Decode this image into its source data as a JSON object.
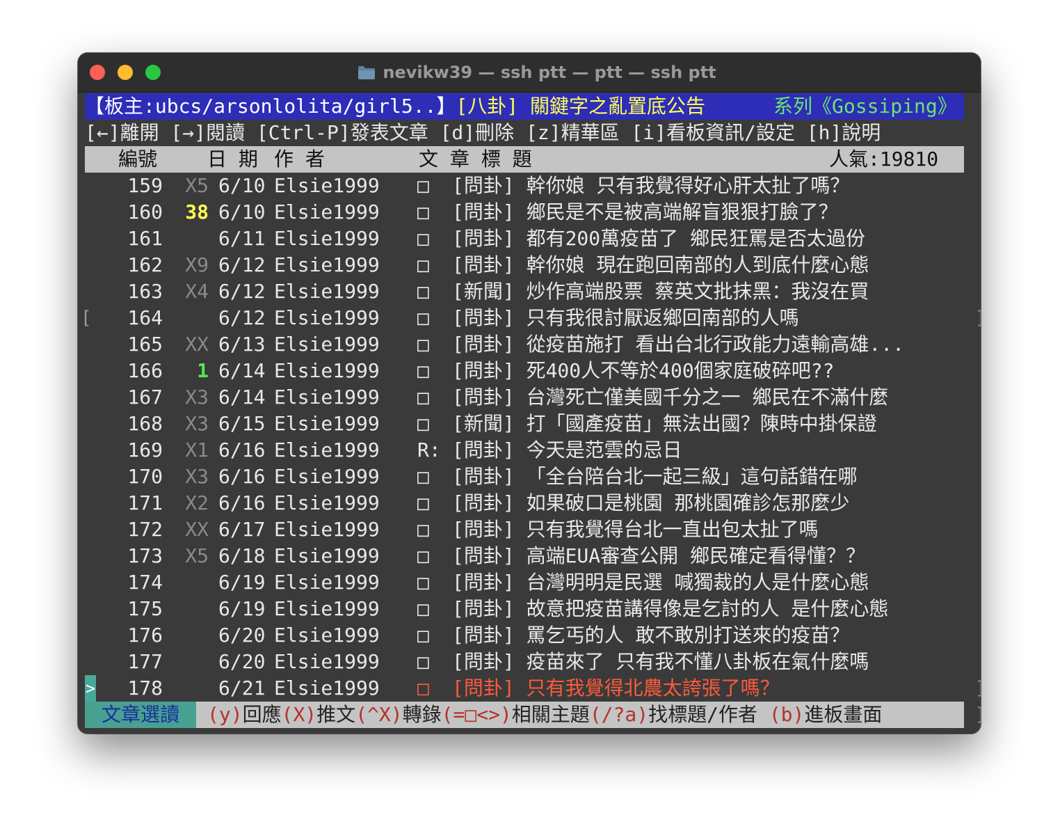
{
  "window": {
    "title": "nevikw39 — ssh ptt — ptt — ssh ptt",
    "buttons": [
      "close",
      "minimize",
      "zoom"
    ]
  },
  "header": {
    "moderators": "【板主:ubcs/arsonlolita/girl5..】",
    "title": "[八卦] 關鍵字之亂置底公告",
    "series": "系列《Gossiping》"
  },
  "menu": "[←]離開 [→]閱讀 [Ctrl-P]發表文章 [d]刪除 [z]精華區 [i]看板資訊/設定 [h]說明",
  "columns": {
    "number": "編號",
    "date": "日 期",
    "author": "作  者",
    "title": "文  章  標  題",
    "popularity": "人氣:19810"
  },
  "posts": [
    {
      "num": "159",
      "rec": "X5",
      "date": "6/10",
      "author": "Elsie1999",
      "mark": "□",
      "title": "[問卦] 幹你娘 只有我覺得好心肝太扯了嗎？"
    },
    {
      "num": "160",
      "rec": "38",
      "date": "6/10",
      "author": "Elsie1999",
      "mark": "□",
      "title": "[問卦] 鄉民是不是被高端解盲狠狠打臉了？"
    },
    {
      "num": "161",
      "rec": "",
      "date": "6/11",
      "author": "Elsie1999",
      "mark": "□",
      "title": "[問卦] 都有200萬疫苗了 鄉民狂罵是否太過份"
    },
    {
      "num": "162",
      "rec": "X9",
      "date": "6/12",
      "author": "Elsie1999",
      "mark": "□",
      "title": "[問卦] 幹你娘 現在跑回南部的人到底什麼心態"
    },
    {
      "num": "163",
      "rec": "X4",
      "date": "6/12",
      "author": "Elsie1999",
      "mark": "□",
      "title": "[新聞] 炒作高端股票 蔡英文批抹黑：我沒在買"
    },
    {
      "num": "164",
      "rec": "",
      "date": "6/12",
      "author": "Elsie1999",
      "mark": "□",
      "title": "[問卦] 只有我很討厭返鄉回南部的人嗎"
    },
    {
      "num": "165",
      "rec": "XX",
      "date": "6/13",
      "author": "Elsie1999",
      "mark": "□",
      "title": "[問卦] 從疫苗施打 看出台北行政能力遠輸高雄..."
    },
    {
      "num": "166",
      "rec": "1",
      "date": "6/14",
      "author": "Elsie1999",
      "mark": "□",
      "title": "[問卦] 死400人不等於400個家庭破碎吧??"
    },
    {
      "num": "167",
      "rec": "X3",
      "date": "6/14",
      "author": "Elsie1999",
      "mark": "□",
      "title": "[問卦] 台灣死亡僅美國千分之一 鄉民在不滿什麼"
    },
    {
      "num": "168",
      "rec": "X3",
      "date": "6/15",
      "author": "Elsie1999",
      "mark": "□",
      "title": "[新聞] 打「國產疫苗」無法出國？陳時中掛保證"
    },
    {
      "num": "169",
      "rec": "X1",
      "date": "6/16",
      "author": "Elsie1999",
      "mark": "R:",
      "title": "[問卦] 今天是范雲的忌日"
    },
    {
      "num": "170",
      "rec": "X3",
      "date": "6/16",
      "author": "Elsie1999",
      "mark": "□",
      "title": "[問卦] 「全台陪台北一起三級」這句話錯在哪"
    },
    {
      "num": "171",
      "rec": "X2",
      "date": "6/16",
      "author": "Elsie1999",
      "mark": "□",
      "title": "[問卦] 如果破口是桃園 那桃園確診怎那麼少"
    },
    {
      "num": "172",
      "rec": "XX",
      "date": "6/17",
      "author": "Elsie1999",
      "mark": "□",
      "title": "[問卦] 只有我覺得台北一直出包太扯了嗎"
    },
    {
      "num": "173",
      "rec": "X5",
      "date": "6/18",
      "author": "Elsie1999",
      "mark": "□",
      "title": "[問卦] 高端EUA審查公開 鄉民確定看得懂？？"
    },
    {
      "num": "174",
      "rec": "",
      "date": "6/19",
      "author": "Elsie1999",
      "mark": "□",
      "title": "[問卦] 台灣明明是民選 喊獨裁的人是什麼心態"
    },
    {
      "num": "175",
      "rec": "",
      "date": "6/19",
      "author": "Elsie1999",
      "mark": "□",
      "title": "[問卦] 故意把疫苗講得像是乞討的人 是什麼心態"
    },
    {
      "num": "176",
      "rec": "",
      "date": "6/20",
      "author": "Elsie1999",
      "mark": "□",
      "title": "[問卦] 罵乞丐的人 敢不敢別打送來的疫苗？"
    },
    {
      "num": "177",
      "rec": "",
      "date": "6/20",
      "author": "Elsie1999",
      "mark": "□",
      "title": "[問卦] 疫苗來了 只有我不懂八卦板在氣什麼嗎"
    },
    {
      "num": "178",
      "rec": "",
      "date": "6/21",
      "author": "Elsie1999",
      "mark": "□",
      "title": "[問卦] 只有我覺得北農太誇張了嗎？"
    }
  ],
  "cursor": ">",
  "footer": {
    "mode": "文章選讀",
    "keys": [
      {
        "key": "(y)",
        "label": "回應"
      },
      {
        "key": "(X)",
        "label": "推文"
      },
      {
        "key": "(^X)",
        "label": "轉錄"
      },
      {
        "key": "(=□<>)",
        "label": "相關主題"
      },
      {
        "key": "(/?a)",
        "label": "找標題/作者 "
      },
      {
        "key": "(b)",
        "label": "進板畫面"
      }
    ]
  },
  "colors": {
    "header_bg": "#2d2db8",
    "selected_title": "#ff5a3c",
    "footer_mode_bg": "#48a090",
    "popularity_rec": "#ffff54"
  }
}
